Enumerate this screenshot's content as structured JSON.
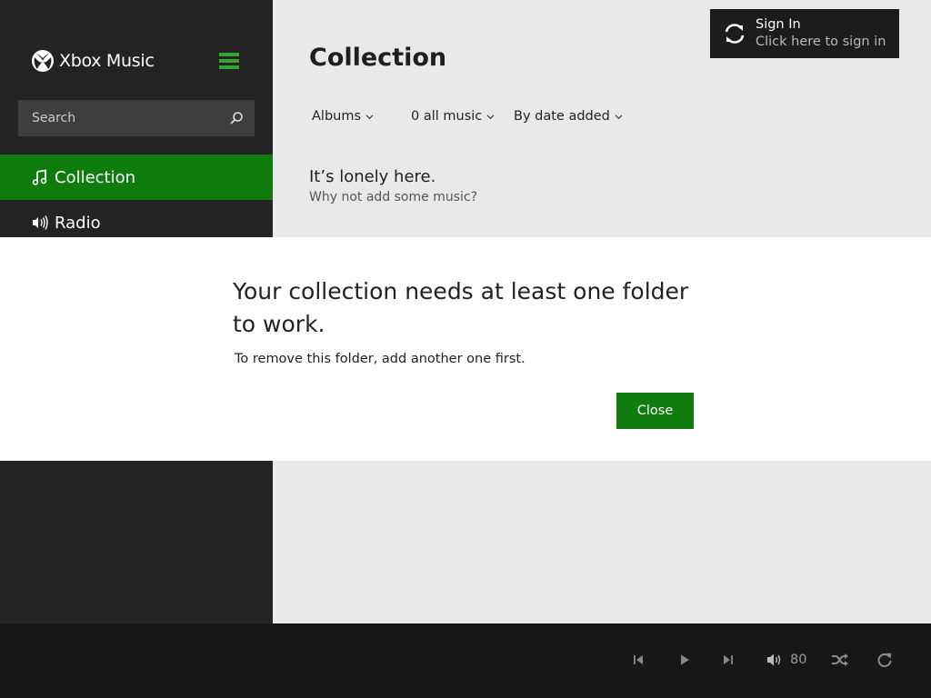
{
  "app": {
    "brand": "Xbox Music"
  },
  "sidebar": {
    "search_placeholder": "Search",
    "items": [
      {
        "label": "Collection",
        "icon": "music-note-icon",
        "active": true
      },
      {
        "label": "Radio",
        "icon": "radio-icon",
        "active": false
      }
    ]
  },
  "main": {
    "title": "Collection",
    "filters": [
      {
        "label": "Albums"
      },
      {
        "label": "0 all music"
      },
      {
        "label": "By date added"
      }
    ],
    "empty_title": "It’s lonely here.",
    "empty_subtitle": "Why not add some music?"
  },
  "signin": {
    "title": "Sign In",
    "subtitle": "Click here to sign in"
  },
  "dialog": {
    "title": "Your collection needs at least one folder to work.",
    "message": "To remove this folder, add another one first.",
    "close_label": "Close"
  },
  "player": {
    "volume": "80",
    "controls": [
      "previous-icon",
      "play-icon",
      "next-icon",
      "volume-icon",
      "shuffle-icon",
      "repeat-icon"
    ]
  },
  "colors": {
    "accent": "#107c10",
    "sidebar_bg": "#232323",
    "main_bg": "#e9e9e9",
    "player_bg": "#171717"
  }
}
